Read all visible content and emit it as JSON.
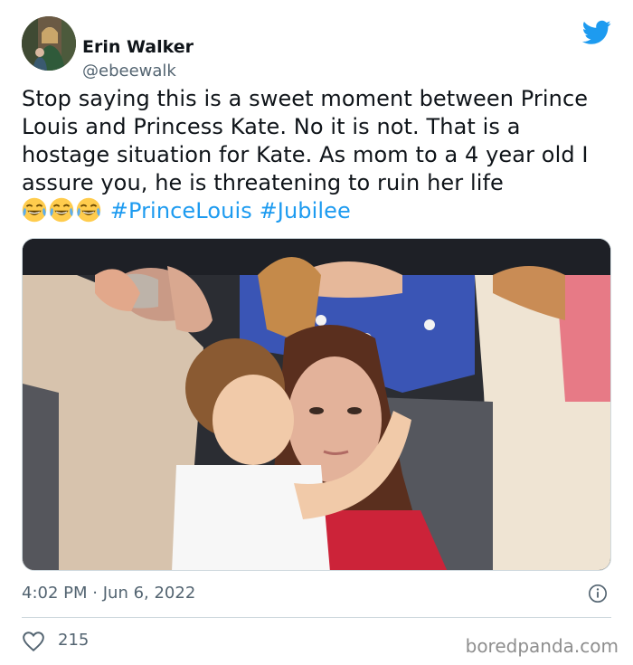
{
  "author": {
    "display_name": "Erin Walker",
    "handle": "@ebeewalk",
    "avatar": "avatar"
  },
  "brand_icon": "twitter-bird-icon",
  "tweet": {
    "text_before": "Stop saying this is a sweet moment between Prince Louis and Princess Kate. No it is not. That is a hostage situation for Kate. As mom to a 4 year old I assure you, he is threatening to ruin her life",
    "emojis": [
      "face-with-tears-of-joy",
      "face-with-tears-of-joy",
      "face-with-tears-of-joy"
    ],
    "hashtags": [
      "#PrinceLouis",
      "#Jubilee"
    ]
  },
  "media": {
    "alt": "tweet-photo"
  },
  "meta": {
    "time": "4:02 PM",
    "separator": "·",
    "date": "Jun 6, 2022"
  },
  "engagement": {
    "likes": "215"
  },
  "watermark": "boredpanda.com",
  "colors": {
    "accent": "#1d9bf0",
    "text": "#0f1419",
    "secondary": "#536471"
  }
}
